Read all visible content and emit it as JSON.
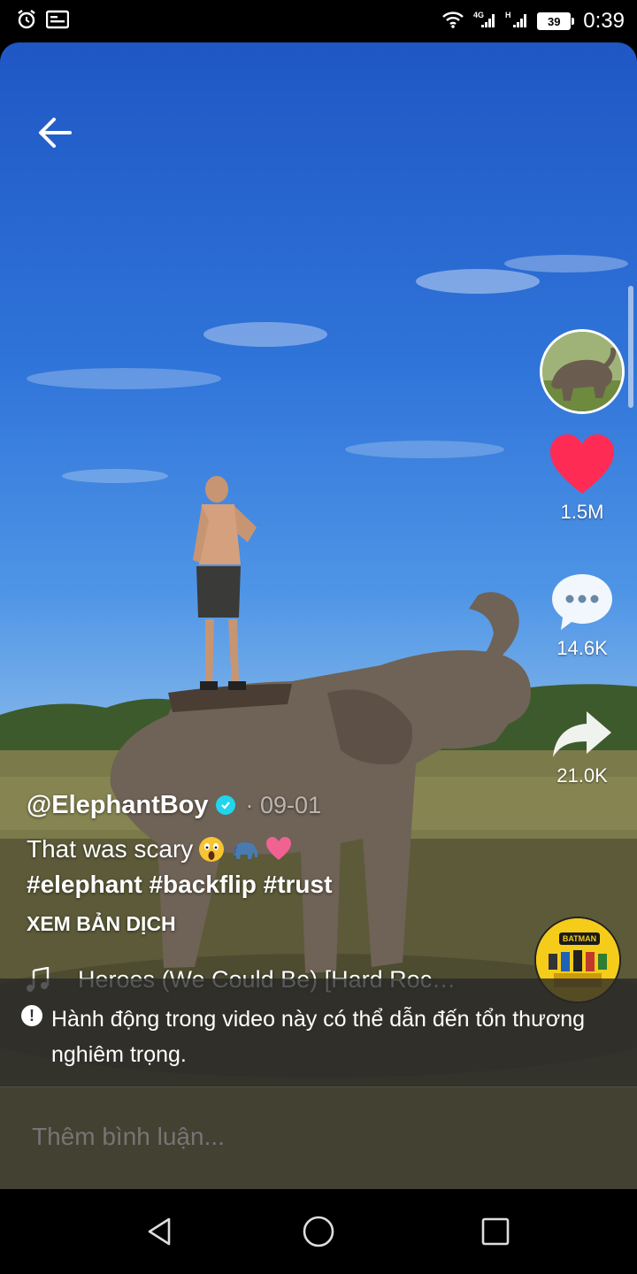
{
  "status_bar": {
    "time": "0:39",
    "battery_level": "39",
    "icons": [
      "alarm-icon",
      "gallery-icon",
      "wifi-icon",
      "signal-4g-icon",
      "signal-icon",
      "battery-icon"
    ]
  },
  "video": {
    "stats": {
      "likes": "1.5M",
      "comments": "14.6K",
      "shares": "21.0K"
    },
    "author": {
      "handle": "@ElephantBoy",
      "date": "· 09-01",
      "verified": true
    },
    "description": "That was scary",
    "hashtags": "#elephant #backflip #trust",
    "translate_label": "XEM BẢN DỊCH",
    "music": {
      "track": "Heroes (We Could Be) [Hard Rock…",
      "disc_label": "BATMAN"
    }
  },
  "warning": {
    "text": "Hành động trong video này có thể dẫn đến tổn thương nghiêm trọng."
  },
  "comment": {
    "placeholder": "Thêm bình luận..."
  },
  "colors": {
    "like": "#fe2c55",
    "verified": "#20d5ec",
    "sky_top": "#1f57c4",
    "disc": "#f5cc1a"
  }
}
